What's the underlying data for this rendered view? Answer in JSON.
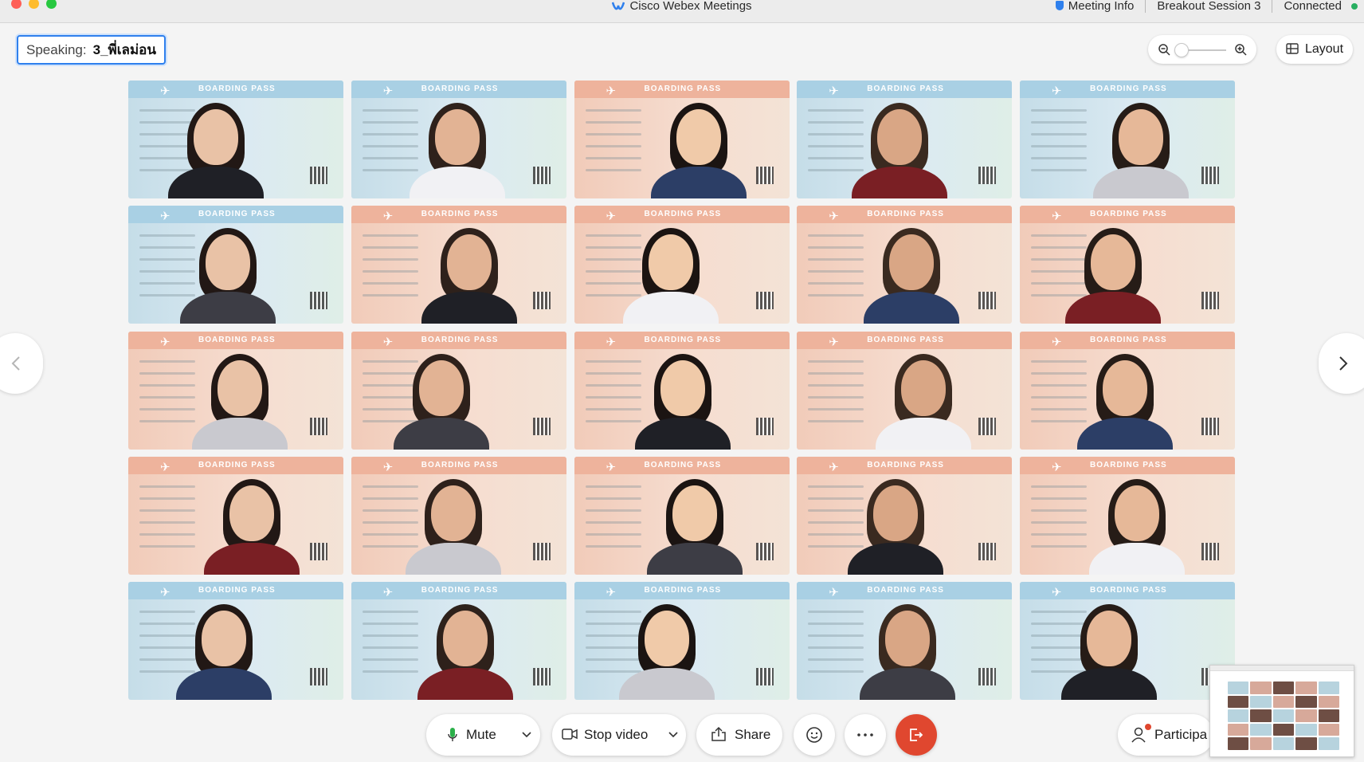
{
  "window": {
    "title": "Cisco Webex Meetings",
    "meeting_info": "Meeting Info",
    "breakout": "Breakout Session 3",
    "connection": "Connected"
  },
  "speaking": {
    "label": "Speaking:",
    "name": "3_พี่เลม่อน"
  },
  "toolbar": {
    "layout_label": "Layout",
    "zoom_level": 0.05
  },
  "grid": {
    "rows": 5,
    "columns": 5,
    "tile_themes": [
      "blue",
      "blue",
      "peach",
      "blue",
      "blue",
      "blue",
      "peach",
      "peach",
      "peach",
      "peach",
      "peach",
      "peach",
      "peach",
      "peach",
      "peach",
      "peach",
      "peach",
      "peach",
      "peach",
      "peach",
      "blue",
      "blue",
      "blue",
      "blue",
      "blue"
    ],
    "tile_heading": "BOARDING PASS"
  },
  "controls": {
    "mute_label": "Mute",
    "video_label": "Stop video",
    "share_label": "Share",
    "participants_label": "Participa"
  },
  "colors": {
    "accent": "#2f80ed",
    "leave": "#e0472f",
    "connected": "#27ae60"
  },
  "icons": [
    "webex-logo-icon",
    "shield-icon",
    "zoom-out-icon",
    "zoom-in-icon",
    "layout-grid-icon",
    "chevron-left-icon",
    "chevron-right-icon",
    "microphone-icon",
    "chevron-down-icon",
    "video-camera-icon",
    "share-icon",
    "reactions-icon",
    "more-icon",
    "leave-icon",
    "participants-icon"
  ]
}
